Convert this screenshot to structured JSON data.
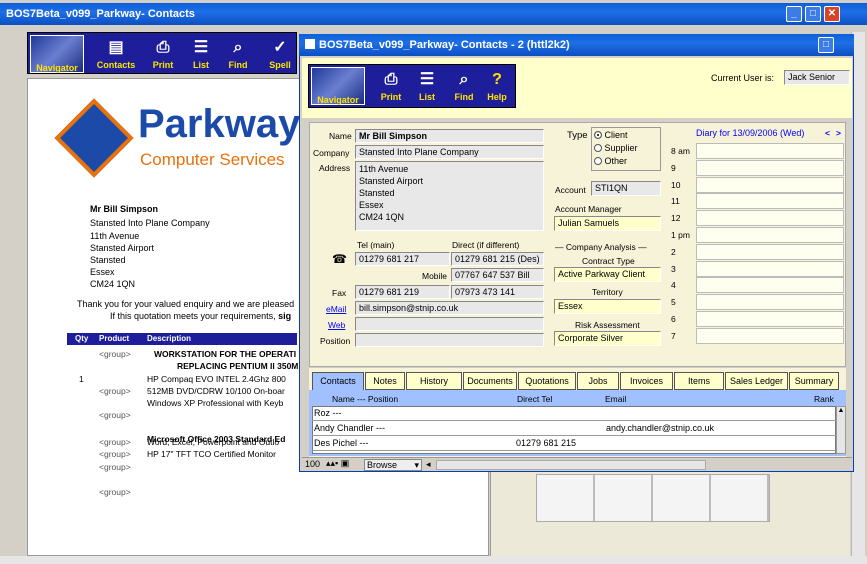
{
  "bg_window": {
    "title": "BOS7Beta_v099_Parkway- Contacts",
    "toolbar": [
      "Navigator",
      "Contacts",
      "Print",
      "List",
      "Find",
      "Spell"
    ]
  },
  "document": {
    "company_line1": "Parkway",
    "company_line2": "Computer Services",
    "address": [
      "Mr Bill Simpson",
      "Stansted Into Plane Company",
      "11th Avenue",
      "Stansted Airport",
      "Stansted",
      "Essex",
      "CM24 1QN"
    ],
    "intro1": "Thank you for your valued enquiry and we are pleased",
    "intro2_a": "If this quotation meets your requirements, ",
    "intro2_b": "sig",
    "table_headers": {
      "qty": "Qty",
      "product": "Product",
      "description": "Description"
    },
    "lines": [
      {
        "qty": "",
        "product": "<group>",
        "desc": "WORKSTATION FOR THE OPERATI",
        "bold": true
      },
      {
        "qty": "",
        "product": "",
        "desc": "REPLACING PENTIUM II 350M",
        "bold": true
      },
      {
        "qty": "1",
        "product": "",
        "desc": "HP Compaq EVO INTEL 2.4Ghz 800",
        "bold": false
      },
      {
        "qty": "",
        "product": "<group>",
        "desc": "512MB DVD/CDRW 10/100 On-boar",
        "bold": false
      },
      {
        "qty": "",
        "product": "",
        "desc": "Windows XP Professional with Keyb",
        "bold": false
      },
      {
        "qty": "",
        "product": "<group>",
        "desc": "",
        "bold": false
      },
      {
        "qty": "",
        "product": "",
        "desc": "Microsoft Office 2003 Standard Ed",
        "bold": true
      },
      {
        "qty": "",
        "product": "<group>",
        "desc": "Word, Excel, Powerpoint and Outlo",
        "bold": false
      },
      {
        "qty": "",
        "product": "<group>",
        "desc": "HP 17\" TFT TCO Certified Monitor",
        "bold": false
      },
      {
        "qty": "",
        "product": "<group>",
        "desc": "",
        "bold": false
      },
      {
        "qty": "",
        "product": "<group>",
        "desc": "",
        "bold": false
      }
    ]
  },
  "fg_window": {
    "title": "BOS7Beta_v099_Parkway- Contacts - 2 (httl2k2)",
    "toolbar": [
      "Navigator",
      "Print",
      "List",
      "Find",
      "Help"
    ],
    "current_user_label": "Current User is:",
    "current_user": "Jack Senior",
    "form": {
      "name_label": "Name",
      "name": "Mr Bill Simpson",
      "company_label": "Company",
      "company": "Stansted Into Plane Company",
      "address_label": "Address",
      "address": [
        "11th Avenue",
        "Stansted Airport",
        "Stansted",
        "Essex",
        "CM24 1QN"
      ],
      "tel_main_label": "Tel (main)",
      "direct_label": "Direct (if different)",
      "tel_main": "01279 681 217",
      "direct": "01279 681 215 (Des)",
      "mobile_label": "Mobile",
      "mobile": "07767 647 537 Bill",
      "fax_label": "Fax",
      "fax": "01279 681 219",
      "fax2": "07973 473 141",
      "email_label": "eMail",
      "email": "bill.simpson@stnip.co.uk",
      "web_label": "Web",
      "position_label": "Position",
      "type_label": "Type",
      "types": [
        "Client",
        "Supplier",
        "Other"
      ],
      "account_label": "Account",
      "account": "STI1QN",
      "acct_mgr_label": "Account Manager",
      "acct_mgr": "Julian Samuels",
      "analysis_label": "Company Analysis",
      "contract_type_label": "Contract Type",
      "contract_type": "Active Parkway Client",
      "territory_label": "Territory",
      "territory": "Essex",
      "risk_label": "Risk Assessment",
      "risk": "Corporate Silver"
    },
    "diary": {
      "title": "Diary for 13/09/2006 (Wed)",
      "prev": "<",
      "next": ">",
      "hours": [
        "8 am",
        "9",
        "10",
        "11",
        "12",
        "1 pm",
        "2",
        "3",
        "4",
        "5",
        "6",
        "7"
      ]
    },
    "tabs": [
      "Contacts",
      "Notes",
      "History",
      "Documents",
      "Quotations",
      "Jobs",
      "Invoices",
      "Items",
      "Sales Ledger",
      "Summary"
    ],
    "contacts_headers": {
      "name": "Name  ---  Position",
      "tel": "Direct Tel",
      "email": "Email",
      "rank": "Rank"
    },
    "contacts": [
      {
        "name": "Roz  ---",
        "tel": "",
        "email": ""
      },
      {
        "name": "Andy Chandler  ---",
        "tel": "",
        "email": "andy.chandler@stnip.co.uk"
      },
      {
        "name": "Des Pichel  ---",
        "tel": "01279 681 215",
        "email": ""
      }
    ],
    "status": {
      "zoom": "100",
      "mode": "Browse"
    }
  },
  "colors": {
    "title": "#0a5fd8",
    "form_bg": "#ffffcc",
    "panel_bg": "#f7f3d8",
    "toolbar": "#1e1e9a",
    "brand_blue": "#1c4aa8",
    "brand_orange": "#e8720c"
  }
}
